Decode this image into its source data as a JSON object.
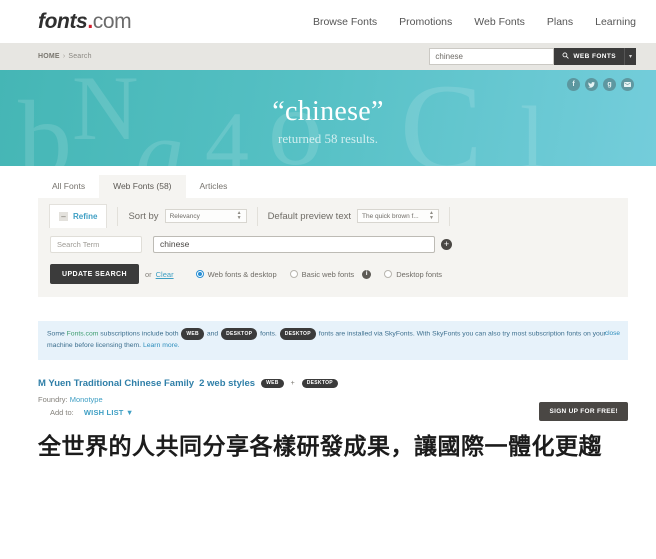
{
  "header": {
    "logo": {
      "bold": "fonts",
      "dot": ".",
      "light": "com"
    },
    "nav": [
      {
        "label": "Browse Fonts"
      },
      {
        "label": "Promotions"
      },
      {
        "label": "Web Fonts"
      },
      {
        "label": "Plans"
      },
      {
        "label": "Learning"
      }
    ]
  },
  "breadcrumb": {
    "home": "HOME",
    "separator": "›",
    "current": "Search"
  },
  "search": {
    "value": "chinese",
    "placeholder": "",
    "button_label": "WEB FONTS",
    "button_icon": "search-icon",
    "caret": "▾"
  },
  "hero": {
    "term": "“chinese”",
    "subtitle": "returned 58 results.",
    "ghost_letters": [
      "b",
      "N",
      "g",
      "4",
      "o",
      "C",
      "l"
    ],
    "social": [
      {
        "name": "facebook-icon",
        "glyph": "f"
      },
      {
        "name": "twitter-icon",
        "glyph": "✉"
      },
      {
        "name": "googleplus-icon",
        "glyph": "g"
      },
      {
        "name": "email-icon",
        "glyph": "✉"
      }
    ],
    "colors": {
      "from": "#45b6b5",
      "to": "#74cddb"
    }
  },
  "tabs": [
    {
      "label": "All Fonts",
      "active": false
    },
    {
      "label": "Web Fonts (58)",
      "active": true
    },
    {
      "label": "Articles",
      "active": false
    }
  ],
  "refine": {
    "toggle_icon": "minus-icon",
    "toggle_glyph": "–",
    "label": "Refine",
    "sort_by_label": "Sort by",
    "sort_by_value": "Relevancy",
    "preview_text_label": "Default preview text",
    "preview_text_value": "The quick brown f...",
    "search_term_label": "Search Term",
    "search_term_value": "chinese",
    "add_term_glyph": "+",
    "update_button": "UPDATE SEARCH",
    "or_text": "or",
    "clear_link": "Clear",
    "options": [
      {
        "label": "Web fonts & desktop",
        "selected": true,
        "info": false
      },
      {
        "label": "Basic web fonts",
        "selected": false,
        "info": true
      },
      {
        "label": "Desktop fonts",
        "selected": false,
        "info": false
      }
    ],
    "info_glyph": "i"
  },
  "notice": {
    "part1": "Some ",
    "brand": "Fonts.com",
    "part2": " subscriptions include both ",
    "pill_web": "WEB",
    "part3": " and ",
    "pill_desktop1": "DESKTOP",
    "part4": " fonts. ",
    "pill_desktop2": "DESKTOP",
    "part5": " fonts are installed via SkyFonts. With SkyFonts you can also try most subscription fonts on your machine before licensing them. ",
    "learn_more": "Learn more.",
    "close": "close"
  },
  "result": {
    "title": "M Yuen Traditional Chinese Family",
    "styles": "2 web styles",
    "badge_web": "WEB",
    "badge_plus": "+",
    "badge_desktop": "DESKTOP",
    "foundry_label": "Foundry:",
    "foundry_value": "Monotype",
    "add_to_label": "Add to:",
    "wish_list": "WISH LIST",
    "wish_caret": "▼",
    "signup_button": "SIGN UP FOR FREE!",
    "preview_text": "全世界的人共同分享各樣研發成果，讓國際一體化更趨"
  }
}
